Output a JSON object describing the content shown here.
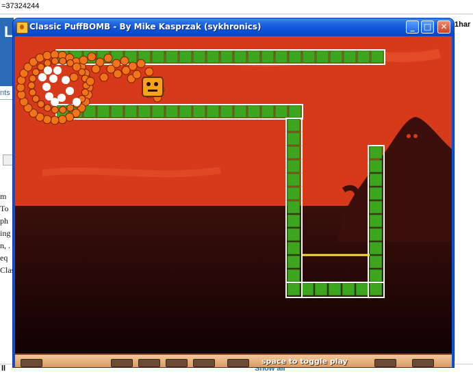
{
  "background": {
    "url_fragment": "=37324244",
    "right_snippet": "1har",
    "left_tab_text": "nts",
    "left_header_letter": "L",
    "left_text_lines": [
      "m",
      "To",
      "ph",
      "ing",
      "n, .",
      "eq",
      "Clas"
    ],
    "bottom_left": "ll",
    "bottom_link": "Show all"
  },
  "window": {
    "title": "Classic PuffBOMB - By Mike Kasprzak (sykhronics)",
    "buttons": {
      "minimize": "_",
      "maximize": "□",
      "close": "✕"
    }
  },
  "game": {
    "hint": "space to toggle play",
    "colors": {
      "sky": "#d63a1a",
      "ground": "#2a0a08",
      "block": "#3da61e",
      "block_edge": "#ffffff",
      "explosion": "#f0741a",
      "mountain": "#3a0f0c"
    }
  }
}
